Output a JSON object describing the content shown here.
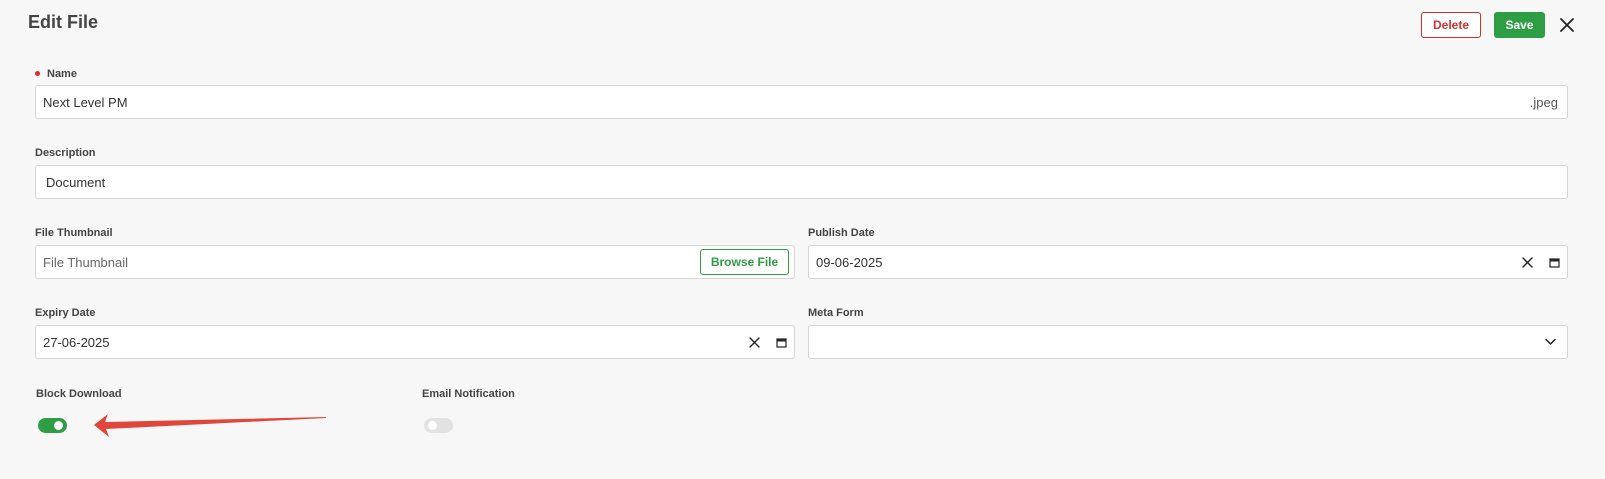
{
  "header": {
    "title": "Edit File",
    "delete_label": "Delete",
    "save_label": "Save"
  },
  "form": {
    "name": {
      "label": "Name",
      "value": "Next Level PM",
      "suffix": ".jpeg",
      "required": true
    },
    "description": {
      "label": "Description",
      "value": "Document"
    },
    "file_thumbnail": {
      "label": "File Thumbnail",
      "placeholder": "File Thumbnail",
      "browse_label": "Browse File"
    },
    "publish_date": {
      "label": "Publish Date",
      "value": "09-06-2025"
    },
    "expiry_date": {
      "label": "Expiry Date",
      "value": "27-06-2025"
    },
    "meta_form": {
      "label": "Meta Form",
      "value": ""
    },
    "block_download": {
      "label": "Block Download",
      "on": true
    },
    "email_notification": {
      "label": "Email Notification",
      "on": false
    }
  },
  "colors": {
    "accent_green": "#2e9e44",
    "danger_red": "#d32f2f",
    "annotation_arrow": "#e0463a",
    "toggle_off": "#e2e2e2"
  },
  "icons": {
    "close": "close-icon",
    "clear": "clear-icon",
    "calendar": "calendar-icon",
    "dropdown": "chevron-down-icon"
  }
}
